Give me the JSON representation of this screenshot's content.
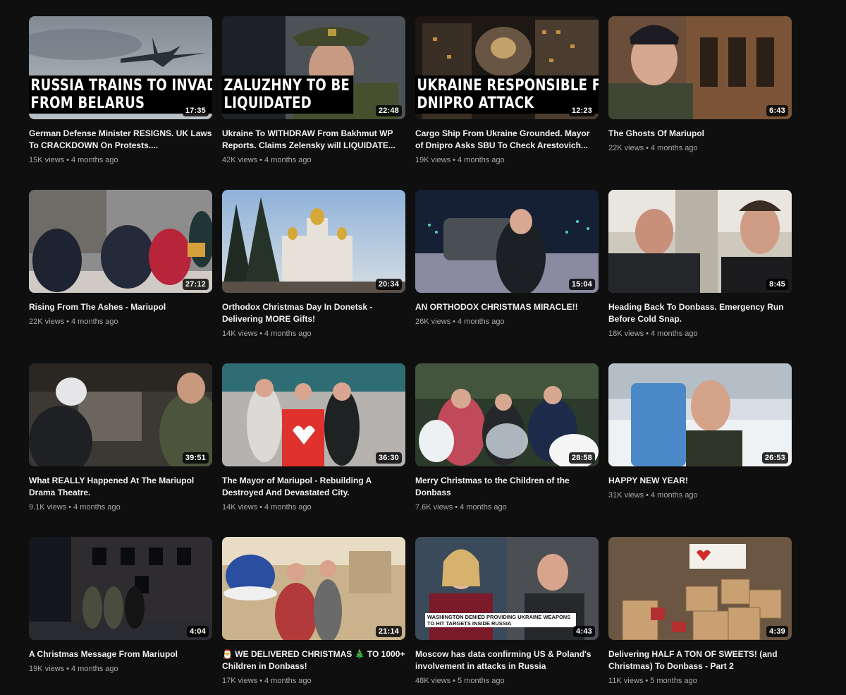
{
  "colors": {
    "background": "#0f0f0f",
    "title": "#f1f1f1",
    "meta": "#aaaaaa"
  },
  "videos": [
    {
      "title": "German Defense Minister RESIGNS. UK Laws To CRACKDOWN On Protests....",
      "views": "15K views",
      "age": "4 months ago",
      "duration": "17:35",
      "overlay": "RUSSIA TRAINS TO INVADE\nFROM BELARUS"
    },
    {
      "title": "Ukraine To WITHDRAW From Bakhmut WP Reports. Claims Zelensky will LIQUIDATE...",
      "views": "42K views",
      "age": "4 months ago",
      "duration": "22:48",
      "overlay": "ZALUZHNY TO BE\nLIQUIDATED"
    },
    {
      "title": "Cargo Ship From Ukraine Grounded. Mayor of Dnipro Asks SBU To Check Arestovich...",
      "views": "19K views",
      "age": "4 months ago",
      "duration": "12:23",
      "overlay": "UKRAINE RESPONSIBLE FOR\nDNIPRO ATTACK"
    },
    {
      "title": "The Ghosts Of Mariupol",
      "views": "22K views",
      "age": "4 months ago",
      "duration": "6:43"
    },
    {
      "title": "Rising From The Ashes - Mariupol",
      "views": "22K views",
      "age": "4 months ago",
      "duration": "27:12"
    },
    {
      "title": "Orthodox Christmas Day In Donetsk - Delivering MORE Gifts!",
      "views": "14K views",
      "age": "4 months ago",
      "duration": "20:34"
    },
    {
      "title": "AN ORTHODOX CHRISTMAS MIRACLE!!",
      "views": "26K views",
      "age": "4 months ago",
      "duration": "15:04"
    },
    {
      "title": "Heading Back To Donbass. Emergency Run Before Cold Snap.",
      "views": "18K views",
      "age": "4 months ago",
      "duration": "8:45"
    },
    {
      "title": "What REALLY Happened At The Mariupol Drama Theatre.",
      "views": "9.1K views",
      "age": "4 months ago",
      "duration": "39:51"
    },
    {
      "title": "The Mayor of Mariupol - Rebuilding A Destroyed And Devastated City.",
      "views": "14K views",
      "age": "4 months ago",
      "duration": "36:30"
    },
    {
      "title": "Merry Christmas to the Children of the Donbass",
      "views": "7.6K views",
      "age": "4 months ago",
      "duration": "28:58"
    },
    {
      "title": "HAPPY NEW YEAR!",
      "views": "31K views",
      "age": "4 months ago",
      "duration": "26:53"
    },
    {
      "title": "A Christmas Message From Mariupol",
      "views": "19K views",
      "age": "4 months ago",
      "duration": "4:04"
    },
    {
      "title": "🎅 WE DELIVERED CHRISTMAS 🎄 TO 1000+ Children in Donbass!",
      "views": "17K views",
      "age": "4 months ago",
      "duration": "21:14"
    },
    {
      "title": "Moscow has data confirming US & Poland's involvement in attacks in Russia",
      "views": "48K views",
      "age": "5 months ago",
      "duration": "4:43",
      "banner": "WASHINGTON DENIED PROVIDING UKRAINE WEAPONS TO HIT TARGETS INSIDE RUSSIA"
    },
    {
      "title": "Delivering HALF A TON OF SWEETS! (and Christmas) To Donbass - Part 2",
      "views": "11K views",
      "age": "5 months ago",
      "duration": "4:39"
    }
  ]
}
